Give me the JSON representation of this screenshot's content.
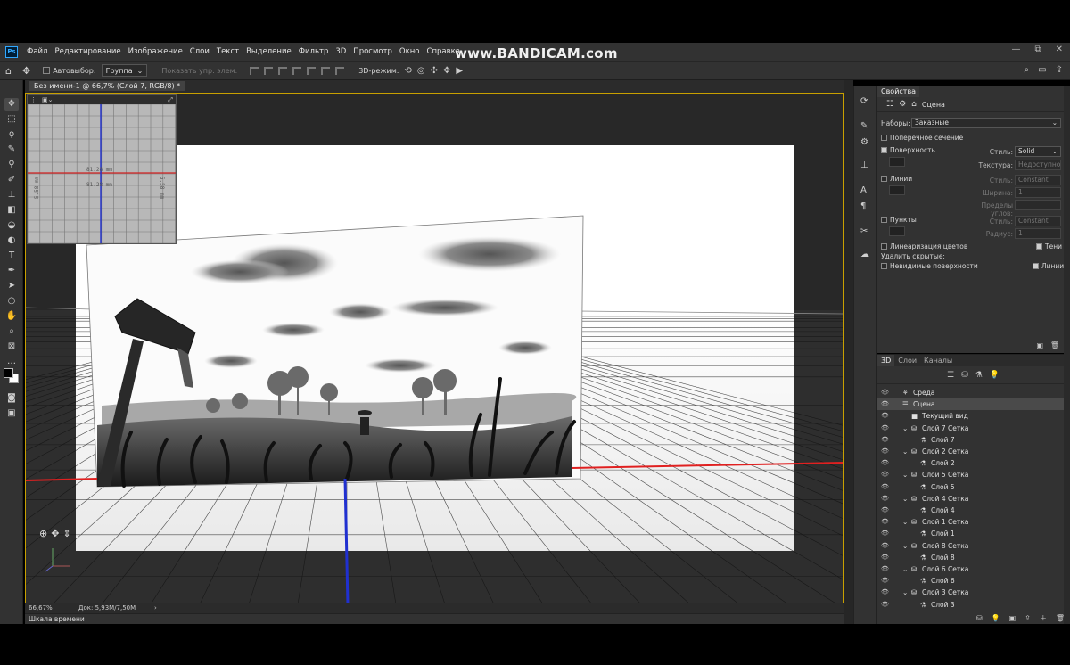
{
  "app": {
    "logo": "Ps",
    "watermark": "www.BANDICAM.com",
    "window_controls": [
      "—",
      "⧉",
      "✕"
    ]
  },
  "menu": [
    "Файл",
    "Редактирование",
    "Изображение",
    "Слои",
    "Текст",
    "Выделение",
    "Фильтр",
    "3D",
    "Просмотр",
    "Окно",
    "Справка"
  ],
  "options": {
    "autoselect_label": "Автовыбор:",
    "autoselect_value": "Группа",
    "show_controls": "Показать упр. элем.",
    "mode3d_label": "3D-режим:"
  },
  "document": {
    "tab": "Без имени-1 @ 66,7% (Слой 7, RGB/8) *",
    "zoom": "66,67%",
    "doc_info": "Док: 5,93M/7,50M",
    "timeline": "Шкала времени"
  },
  "secondary_view": {
    "width_label": "81.28 mm",
    "height_label": "5.58 mm",
    "depth_label": "81.28 mm"
  },
  "properties": {
    "title": "Свойства",
    "scene_label": "Сцена",
    "presets_label": "Наборы:",
    "presets_value": "Заказные",
    "cross_section": "Поперечное сечение",
    "surface": "Поверхность",
    "style_label": "Стиль:",
    "surface_style": "Solid",
    "texture_label": "Текстура:",
    "texture_value": "Недоступно",
    "lines": "Линии",
    "lines_style": "Constant",
    "width_label": "Ширина:",
    "width_value": "1",
    "angle_label": "Пределы углов:",
    "points": "Пункты",
    "points_style": "Constant",
    "radius_label": "Радиус:",
    "radius_value": "1",
    "linearize": "Линеаризация цветов",
    "shadows": "Тени",
    "remove_hidden": "Удалить скрытые:",
    "invisible_surfaces": "Невидимые поверхности",
    "lines_check": "Линии"
  },
  "layers_panel": {
    "tabs": [
      "3D",
      "Слои",
      "Каналы"
    ],
    "items": [
      {
        "name": "Среда",
        "indent": 0,
        "type": "env"
      },
      {
        "name": "Сцена",
        "indent": 0,
        "type": "scene",
        "selected": true
      },
      {
        "name": "Текущий вид",
        "indent": 1,
        "type": "camera"
      },
      {
        "name": "Слой 7 Сетка",
        "indent": 1,
        "type": "mesh"
      },
      {
        "name": "Слой 7",
        "indent": 2,
        "type": "material"
      },
      {
        "name": "Слой 2 Сетка",
        "indent": 1,
        "type": "mesh"
      },
      {
        "name": "Слой 2",
        "indent": 2,
        "type": "material"
      },
      {
        "name": "Слой 5 Сетка",
        "indent": 1,
        "type": "mesh"
      },
      {
        "name": "Слой 5",
        "indent": 2,
        "type": "material"
      },
      {
        "name": "Слой 4 Сетка",
        "indent": 1,
        "type": "mesh"
      },
      {
        "name": "Слой 4",
        "indent": 2,
        "type": "material"
      },
      {
        "name": "Слой 1 Сетка",
        "indent": 1,
        "type": "mesh"
      },
      {
        "name": "Слой 1",
        "indent": 2,
        "type": "material"
      },
      {
        "name": "Слой 8 Сетка",
        "indent": 1,
        "type": "mesh"
      },
      {
        "name": "Слой 8",
        "indent": 2,
        "type": "material"
      },
      {
        "name": "Слой 6 Сетка",
        "indent": 1,
        "type": "mesh"
      },
      {
        "name": "Слой 6",
        "indent": 2,
        "type": "material"
      },
      {
        "name": "Слой 3 Сетка",
        "indent": 1,
        "type": "mesh"
      },
      {
        "name": "Слой 3",
        "indent": 2,
        "type": "material"
      }
    ]
  },
  "colors": {
    "accent_frame": "#c8a000",
    "x_axis": "#e02020",
    "y_axis": "#2030d0",
    "ps_blue": "#31a8ff"
  }
}
